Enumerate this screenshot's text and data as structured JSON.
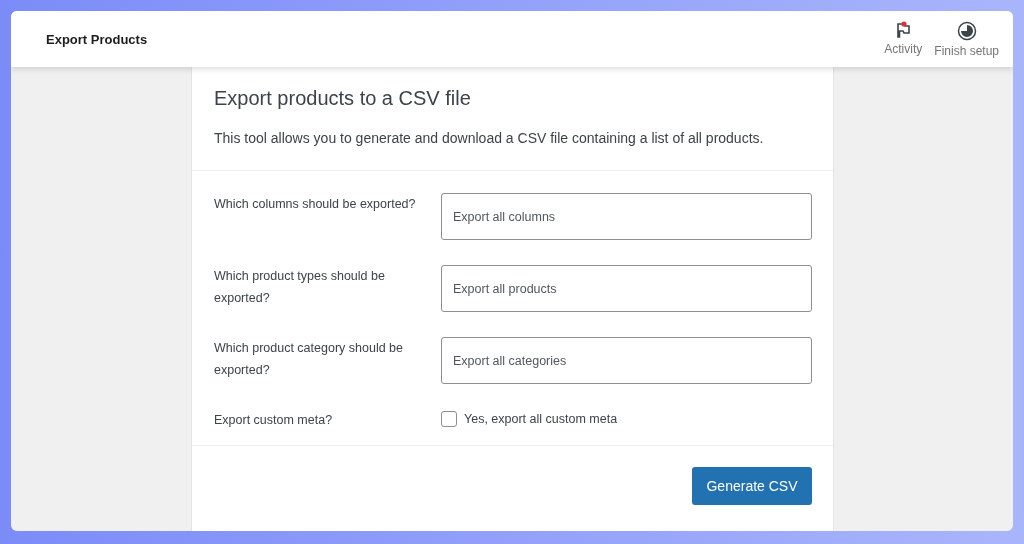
{
  "header": {
    "title": "Export Products",
    "actions": [
      {
        "kind": "activity",
        "label": "Activity",
        "notification": true
      },
      {
        "kind": "setup",
        "label": "Finish setup",
        "notification": false
      }
    ]
  },
  "card": {
    "title": "Export products to a CSV file",
    "description": "This tool allows you to generate and download a CSV file containing a list of all products.",
    "fields": [
      {
        "kind": "select",
        "label": "Which columns should be exported?",
        "placeholder": "Export all columns"
      },
      {
        "kind": "select",
        "label": "Which product types should be exported?",
        "placeholder": "Export all products"
      },
      {
        "kind": "select",
        "label": "Which product category should be exported?",
        "placeholder": "Export all categories"
      },
      {
        "kind": "checkbox",
        "label": "Export custom meta?",
        "option": "Yes, export all custom meta",
        "checked": false
      }
    ],
    "button": "Generate CSV"
  }
}
